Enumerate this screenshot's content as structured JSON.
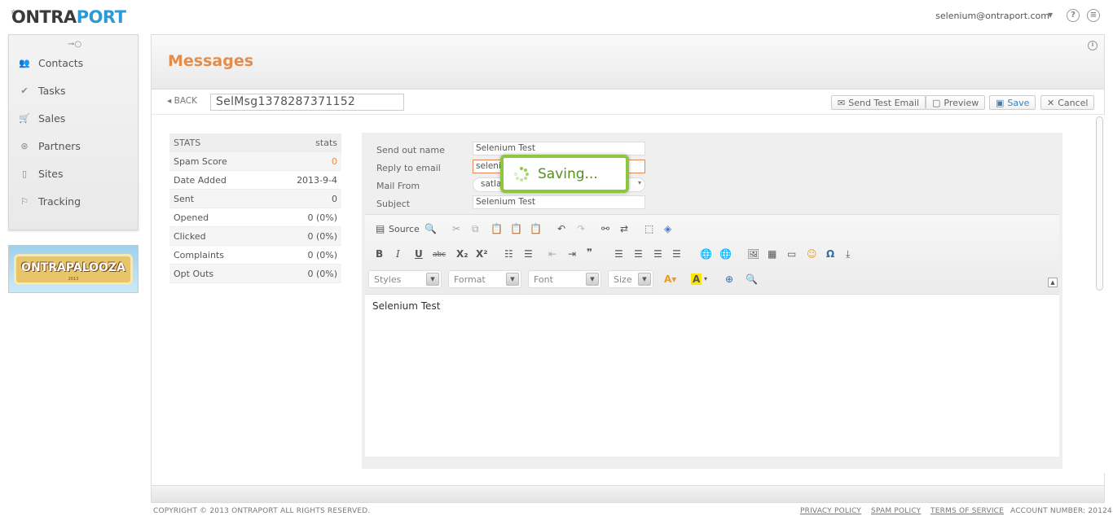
{
  "app": {
    "logo_onta": "ONTRA",
    "logo_port": "PORT",
    "user_email": "selenium@ontraport.com"
  },
  "sidebar": {
    "items": [
      {
        "label": "Contacts",
        "icon": "contacts-icon"
      },
      {
        "label": "Tasks",
        "icon": "tasks-icon"
      },
      {
        "label": "Sales",
        "icon": "cart-icon"
      },
      {
        "label": "Partners",
        "icon": "partners-icon"
      },
      {
        "label": "Sites",
        "icon": "sites-icon"
      },
      {
        "label": "Tracking",
        "icon": "tracking-icon"
      }
    ],
    "banner_text": "ONTRAPALOOZA",
    "banner_year": "2013"
  },
  "page": {
    "title": "Messages",
    "back_label": "BACK",
    "message_name": "SelMsg1378287371152"
  },
  "actions": {
    "send_test": "Send Test Email",
    "preview": "Preview",
    "save": "Save",
    "cancel": "Cancel"
  },
  "stats": {
    "header_left": "STATS",
    "header_right": "stats",
    "rows": [
      {
        "label": "Spam Score",
        "value": "0"
      },
      {
        "label": "Date Added",
        "value": "2013-9-4"
      },
      {
        "label": "Sent",
        "value": "0"
      },
      {
        "label": "Opened",
        "value": "0 (0%)"
      },
      {
        "label": "Clicked",
        "value": "0 (0%)"
      },
      {
        "label": "Complaints",
        "value": "0 (0%)"
      },
      {
        "label": "Opt Outs",
        "value": "0 (0%)"
      }
    ]
  },
  "form": {
    "send_out_name_label": "Send out name",
    "send_out_name": "Selenium Test",
    "reply_to_label": "Reply to email",
    "reply_to": "seleni",
    "mail_from_label": "Mail From",
    "mail_from": "satla",
    "subject_label": "Subject",
    "subject": "Selenium Test"
  },
  "editor": {
    "source_label": "Source",
    "styles": "Styles",
    "format": "Format",
    "font": "Font",
    "size": "Size",
    "content": "Selenium Test"
  },
  "saving_text": "Saving...",
  "footer": {
    "copyright": "COPYRIGHT © 2013 ONTRAPORT ALL RIGHTS RESERVED.",
    "privacy": "PRIVACY POLICY",
    "spam": "SPAM POLICY",
    "terms": "TERMS OF SERVICE",
    "account": "ACCOUNT NUMBER: 20124"
  },
  "colors": {
    "accent": "#e28d4b",
    "brand_blue": "#2a9bd8",
    "saving_green": "#8dc63f"
  }
}
